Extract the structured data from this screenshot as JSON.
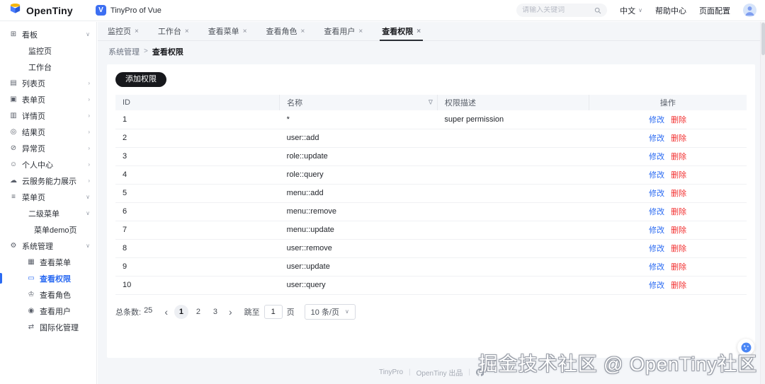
{
  "colors": {
    "accent": "#2a6af2",
    "danger": "#f23030",
    "badge_blue": "#3d6ff2",
    "button_dark": "#17181c",
    "main_bg": "#f4f6f9"
  },
  "ui": {
    "close": "×",
    "chevron_down": "∨",
    "chevron_right": "›",
    "filter": "∇",
    "arrow_prev": "‹",
    "arrow_next": "›",
    "divider": "|",
    "breadcrumb_sep": ">"
  },
  "icons": {
    "dashboard": "⊞",
    "list": "▤",
    "form": "▣",
    "detail": "▥",
    "result": "◎",
    "exception": "⊘",
    "user_center": "☺",
    "cloud": "☁",
    "menu_page": "≡",
    "system": "⚙",
    "view_menu": "▦",
    "view_permission": "▭",
    "view_role": "♔",
    "view_user": "◉",
    "i18n": "⇄"
  },
  "header": {
    "logo_text": "OpenTiny",
    "badge_letter": "V",
    "product_name": "TinyPro of Vue",
    "search_placeholder": "请输入关键词",
    "language": "中文",
    "help_center": "帮助中心",
    "page_config": "页面配置"
  },
  "sidebar": {
    "items": [
      {
        "label": "看板"
      },
      {
        "label": "监控页"
      },
      {
        "label": "工作台"
      },
      {
        "label": "列表页"
      },
      {
        "label": "表单页"
      },
      {
        "label": "详情页"
      },
      {
        "label": "结果页"
      },
      {
        "label": "异常页"
      },
      {
        "label": "个人中心"
      },
      {
        "label": "云服务能力展示"
      },
      {
        "label": "菜单页"
      },
      {
        "label": "二级菜单"
      },
      {
        "label": "菜单demo页"
      },
      {
        "label": "系统管理"
      },
      {
        "label": "查看菜单"
      },
      {
        "label": "查看权限"
      },
      {
        "label": "查看角色"
      },
      {
        "label": "查看用户"
      },
      {
        "label": "国际化管理"
      }
    ]
  },
  "tabs": [
    {
      "label": "监控页"
    },
    {
      "label": "工作台"
    },
    {
      "label": "查看菜单"
    },
    {
      "label": "查看角色"
    },
    {
      "label": "查看用户"
    },
    {
      "label": "查看权限",
      "active": true
    }
  ],
  "breadcrumb": {
    "parent": "系统管理",
    "current": "查看权限"
  },
  "toolbar": {
    "add_button": "添加权限"
  },
  "table": {
    "columns": {
      "id": "ID",
      "name": "名称",
      "desc": "权限描述",
      "actions": "操作"
    },
    "actions": {
      "edit": "修改",
      "delete": "删除"
    },
    "rows": [
      {
        "id": "1",
        "name": "*",
        "desc": "super permission"
      },
      {
        "id": "2",
        "name": "user::add",
        "desc": ""
      },
      {
        "id": "3",
        "name": "role::update",
        "desc": ""
      },
      {
        "id": "4",
        "name": "role::query",
        "desc": ""
      },
      {
        "id": "5",
        "name": "menu::add",
        "desc": ""
      },
      {
        "id": "6",
        "name": "menu::remove",
        "desc": ""
      },
      {
        "id": "7",
        "name": "menu::update",
        "desc": ""
      },
      {
        "id": "8",
        "name": "user::remove",
        "desc": ""
      },
      {
        "id": "9",
        "name": "user::update",
        "desc": ""
      },
      {
        "id": "10",
        "name": "user::query",
        "desc": ""
      }
    ]
  },
  "pagination": {
    "total_label": "总条数:",
    "total": "25",
    "pages": [
      "1",
      "2",
      "3"
    ],
    "current_page": "1",
    "goto_label": "跳至",
    "goto_value": "1",
    "goto_suffix": "页",
    "page_size": "10 条/页"
  },
  "footer": {
    "brand": "TinyPro",
    "credit": "OpenTiny 出品"
  },
  "watermark": "掘金技术社区 @ OpenTiny社区"
}
